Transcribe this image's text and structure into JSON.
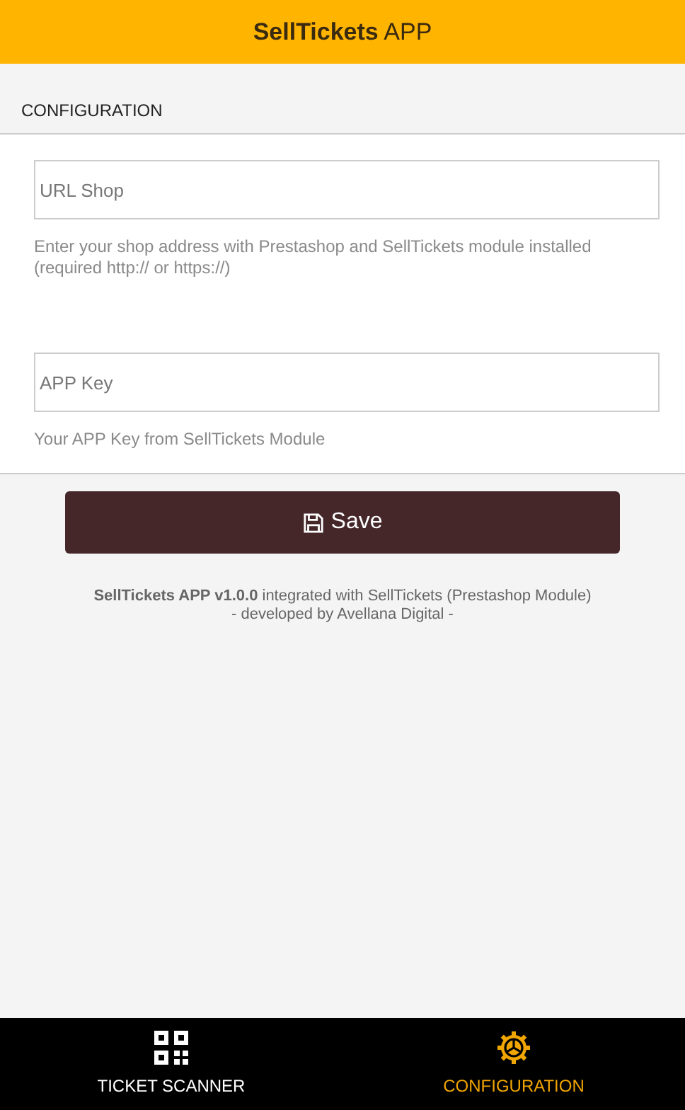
{
  "header": {
    "title": "**SellTickets** APP"
  },
  "section": {
    "title": "CONFIGURATION"
  },
  "fields": [
    {
      "placeholder": "URL Shop",
      "help": "Enter your shop address with Prestashop and SellTickets module installed (required http:// or https://)"
    },
    {
      "placeholder": "APP Key",
      "help": "Your APP Key from SellTickets Module"
    }
  ],
  "save_button": {
    "label": "Save"
  },
  "credits": [
    "**SellTickets APP v1.0.0** integrated with SellTickets (Prestashop Module)",
    "- developed by Avellana Digital -"
  ],
  "tabs": [
    {
      "label": "TICKET SCANNER",
      "kind": "qr",
      "selected": false
    },
    {
      "label": "CONFIGURATION",
      "kind": "gear",
      "selected": true
    }
  ]
}
